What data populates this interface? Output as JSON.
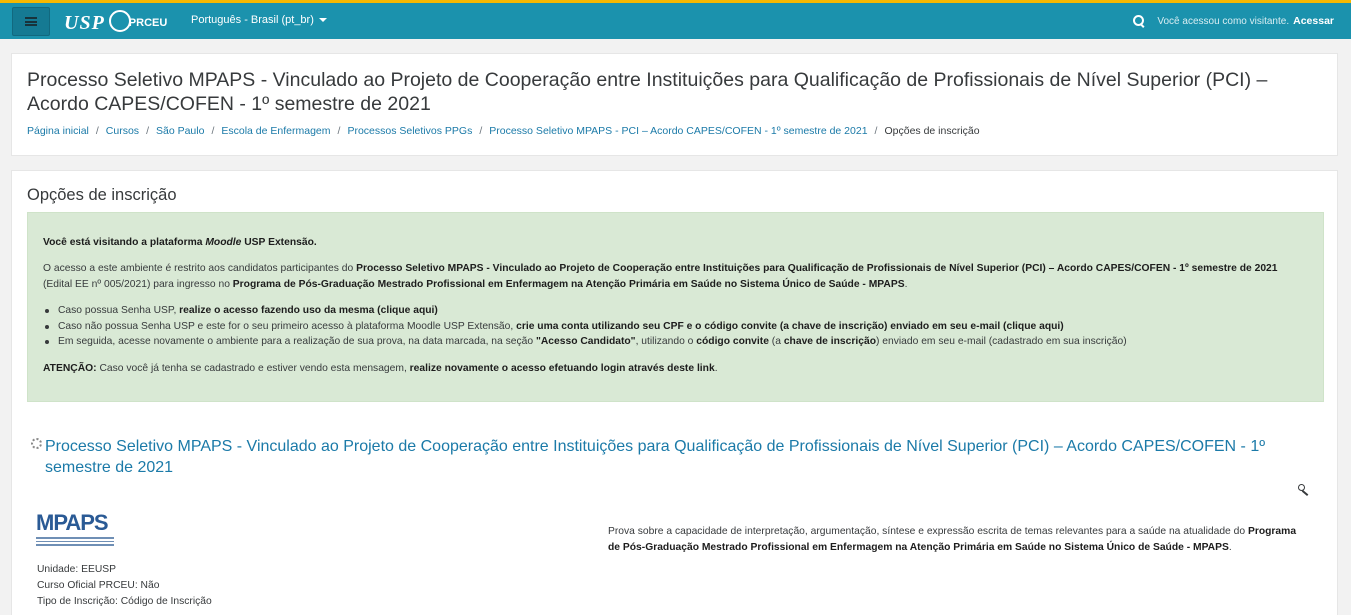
{
  "navbar": {
    "logo_usp": "USP",
    "logo_prceu": "PRCEU",
    "language": "Português - Brasil (pt_br)",
    "visitor_text": "Você acessou como visitante.",
    "login_label": "Acessar",
    "bg_color": "#1b92ad",
    "accent_color": "#f5b800"
  },
  "header": {
    "title": "Processo Seletivo MPAPS - Vinculado ao Projeto de Cooperação entre Instituições para Qualificação de Profissionais de Nível Superior (PCI) – Acordo CAPES/COFEN - 1º semestre de 2021",
    "breadcrumb": [
      "Página inicial",
      "Cursos",
      "São Paulo",
      "Escola de Enfermagem",
      "Processos Seletivos PPGs",
      "Processo Seletivo MPAPS - PCI – Acordo CAPES/COFEN - 1º semestre de 2021",
      "Opções de inscrição"
    ]
  },
  "main": {
    "section_title": "Opções de inscrição",
    "notice": {
      "intro_a": "Você está visitando a plataforma ",
      "intro_italic": "Moodle",
      "intro_b": " USP Extensão.",
      "p2_a": "O acesso a este ambiente é restrito aos candidatos participantes do ",
      "p2_bold": "Processo Seletivo MPAPS - Vinculado ao Projeto de Cooperação entre Instituições para Qualificação de Profissionais de Nível Superior (PCI) – Acordo CAPES/COFEN - 1º semestre de 2021",
      "p2_b": " (Edital EE nº 005/2021) para ingresso no ",
      "p2_bold2": "Programa de Pós-Graduação Mestrado Profissional em Enfermagem na Atenção Primária em Saúde no Sistema Único de Saúde - MPAPS",
      "p2_c": ".",
      "li1_a": "Caso possua Senha USP, ",
      "li1_link": "realize o acesso fazendo uso da mesma (clique aqui)",
      "li2_a": "Caso não possua Senha USP e este for o seu primeiro acesso à plataforma Moodle USP Extensão, ",
      "li2_link": "crie uma conta utilizando seu CPF e o código convite (a chave de inscrição) enviado em seu e-mail (clique aqui)",
      "li3_a": "Em seguida, acesse novamente o ambiente para a realização de sua prova, na data marcada, na seção ",
      "li3_bold": "\"Acesso Candidato\"",
      "li3_b": ", utilizando o ",
      "li3_bold2": "código convite",
      "li3_c": " (a ",
      "li3_bold3": "chave de inscrição",
      "li3_d": ") enviado em seu e-mail (cadastrado em sua inscrição)",
      "att_label": "ATENÇÃO:",
      "att_a": " Caso você já tenha se cadastrado e estiver vendo esta mensagem, ",
      "att_link": "realize novamente o acesso efetuando login através deste link",
      "att_b": "."
    },
    "course_title": "Processo Seletivo MPAPS - Vinculado ao Projeto de Cooperação entre Instituições para Qualificação de Profissionais de Nível Superior (PCI) – Acordo CAPES/COFEN - 1º semestre de 2021",
    "course_logo": "MPAPS",
    "meta": {
      "unidade": "Unidade: EEUSP",
      "curso_oficial": "Curso Oficial PRCEU: Não",
      "tipo": "Tipo de Inscrição: Código de Inscrição"
    },
    "summary_a": "Prova sobre a capacidade de interpretação, argumentação, síntese e expressão escrita de temas relevantes para a saúde na atualidade do ",
    "summary_bold": "Programa de Pós-Graduação Mestrado Profissional em Enfermagem na Atenção Primária em Saúde no Sistema Único de Saúde - MPAPS",
    "summary_b": "."
  }
}
